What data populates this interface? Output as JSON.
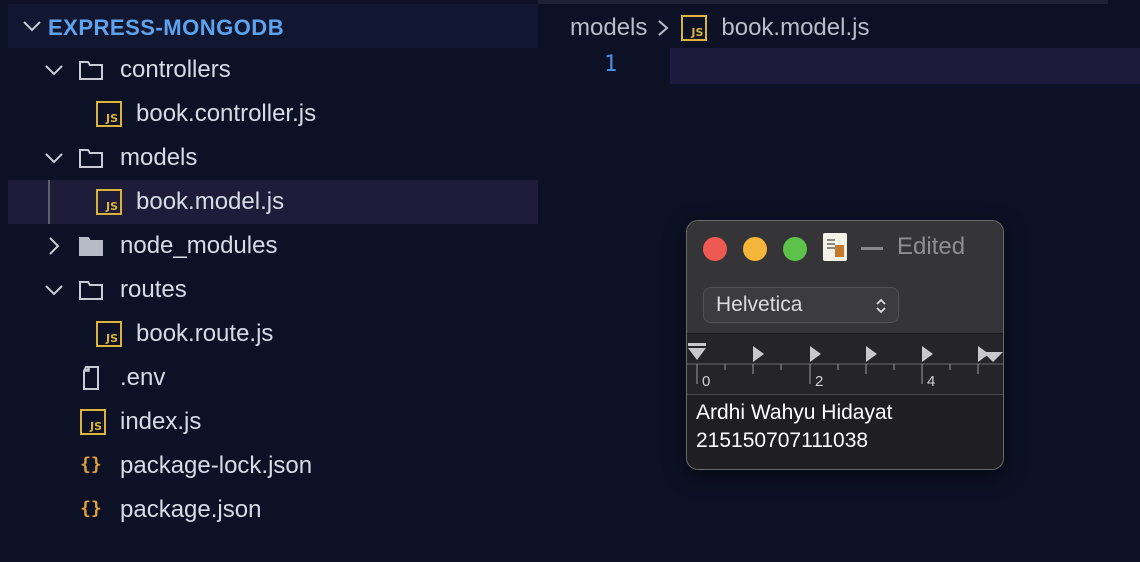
{
  "explorer": {
    "title": "EXPRESS-MONGODB",
    "items": [
      {
        "label": "controllers",
        "type": "folder",
        "expanded": true,
        "icon": "folder-open-icon"
      },
      {
        "label": "book.controller.js",
        "type": "js-file",
        "icon": "js-file-icon"
      },
      {
        "label": "models",
        "type": "folder",
        "expanded": true,
        "icon": "folder-open-icon"
      },
      {
        "label": "book.model.js",
        "type": "js-file",
        "icon": "js-file-icon",
        "selected": true
      },
      {
        "label": "node_modules",
        "type": "folder",
        "expanded": false,
        "icon": "folder-closed-icon"
      },
      {
        "label": "routes",
        "type": "folder",
        "expanded": true,
        "icon": "folder-open-icon"
      },
      {
        "label": "book.route.js",
        "type": "js-file",
        "icon": "js-file-icon"
      },
      {
        "label": ".env",
        "type": "file",
        "icon": "file-icon"
      },
      {
        "label": "index.js",
        "type": "js-file",
        "icon": "js-file-icon"
      },
      {
        "label": "package-lock.json",
        "type": "json-file",
        "icon": "json-icon"
      },
      {
        "label": "package.json",
        "type": "json-file",
        "icon": "json-icon"
      }
    ]
  },
  "editor": {
    "breadcrumb": {
      "folder": "models",
      "file": "book.model.js"
    },
    "line_number": "1",
    "js_badge": "JS"
  },
  "textedit": {
    "title_status": "Edited",
    "font": "Helvetica",
    "ruler_labels": [
      "0",
      "2",
      "4"
    ],
    "content_lines": [
      "Ardhi Wahyu Hidayat",
      "215150707111038"
    ]
  },
  "colors": {
    "background": "#0c1125",
    "accent_title": "#5ea3ef",
    "js_yellow": "#d9b33c",
    "json_orange": "#e0a13a",
    "selection": "#1f1c39",
    "traffic_red": "#ee5a52",
    "traffic_yellow": "#f5b43a",
    "traffic_green": "#5cc24a"
  }
}
